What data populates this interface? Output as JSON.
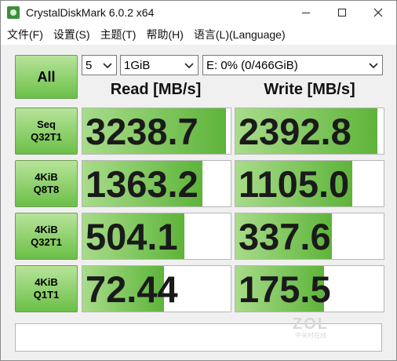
{
  "window": {
    "title": "CrystalDiskMark 6.0.2 x64"
  },
  "menu": [
    "文件(F)",
    "设置(S)",
    "主题(T)",
    "帮助(H)",
    "语言(L)(Language)"
  ],
  "controls": {
    "all_label": "All",
    "count": "5",
    "size": "1GiB",
    "drive": "E: 0% (0/466GiB)"
  },
  "headers": {
    "read": "Read [MB/s]",
    "write": "Write [MB/s]"
  },
  "tests": [
    {
      "line1": "Seq",
      "line2": "Q32T1",
      "read": "3238.7",
      "write": "2392.8",
      "read_fill": 0.97,
      "write_fill": 0.96
    },
    {
      "line1": "4KiB",
      "line2": "Q8T8",
      "read": "1363.2",
      "write": "1105.0",
      "read_fill": 0.81,
      "write_fill": 0.79
    },
    {
      "line1": "4KiB",
      "line2": "Q32T1",
      "read": "504.1",
      "write": "337.6",
      "read_fill": 0.69,
      "write_fill": 0.65
    },
    {
      "line1": "4KiB",
      "line2": "Q1T1",
      "read": "72.44",
      "write": "175.5",
      "read_fill": 0.55,
      "write_fill": 0.6
    }
  ],
  "watermark": {
    "main": "ZOL",
    "sub": "中关村在线"
  }
}
